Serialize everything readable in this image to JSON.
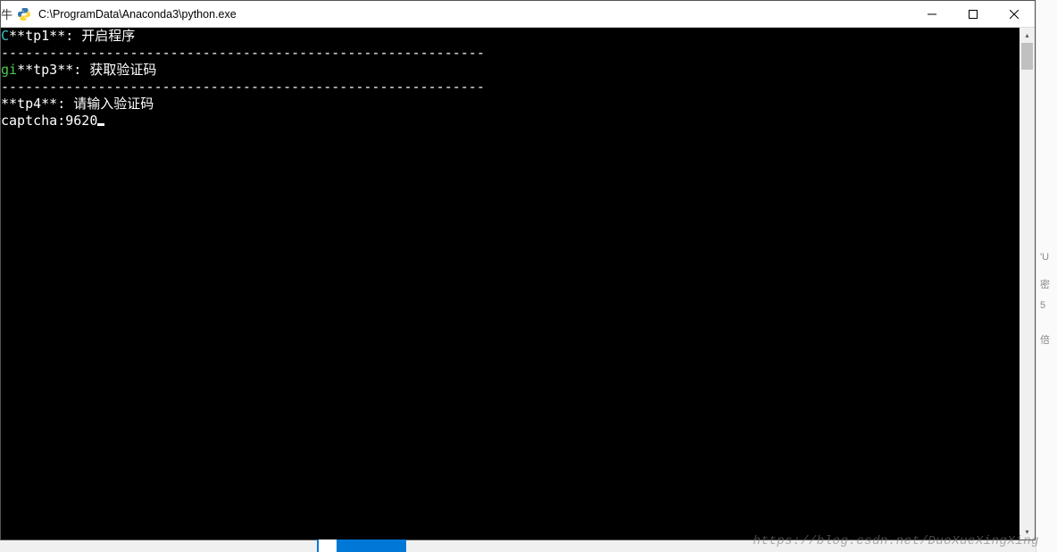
{
  "window": {
    "left_char": "牛",
    "title": "C:\\ProgramData\\Anaconda3\\python.exe"
  },
  "console": {
    "lines": [
      {
        "prefix": "C",
        "prefix_class": "line-prefix-cyan",
        "tag": "**tp1**:",
        "msg": " 开启程序"
      },
      {
        "sep": "------------------------------------------------------------"
      },
      {
        "prefix": "gi",
        "prefix_class": "line-prefix-green",
        "tag": "**tp3**:",
        "msg": " 获取验证码"
      },
      {
        "sep": "------------------------------------------------------------"
      },
      {
        "prefix": "",
        "prefix_class": "",
        "tag": "**tp4**:",
        "msg": " 请输入验证码"
      }
    ],
    "prompt_label": "captcha:",
    "prompt_value": "9620"
  },
  "right_strip": {
    "a": "'U",
    "b": "密",
    "c": "5",
    "d": "倍"
  },
  "watermark": "https://blog.csdn.net/DuoXueXingXing"
}
